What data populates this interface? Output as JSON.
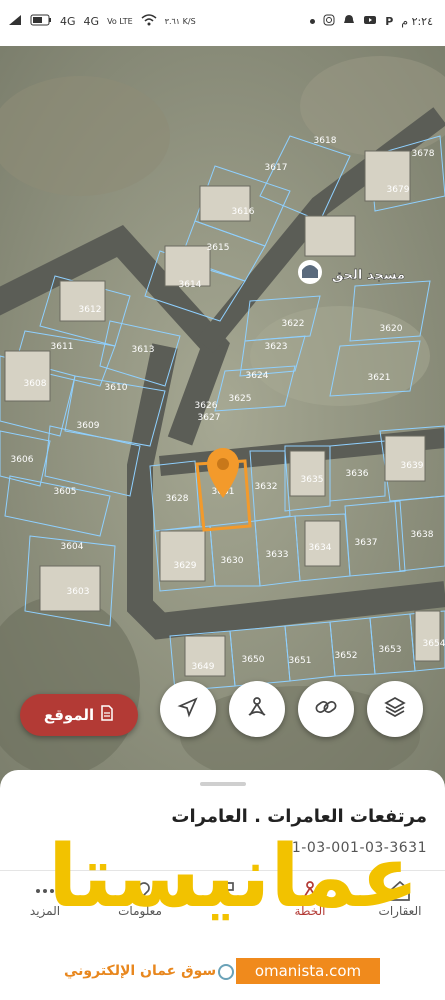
{
  "status_bar": {
    "network_1": "4G",
    "network_2": "4G",
    "volte": "Vo LTE",
    "speed": "٣.٦١ K/S",
    "time": "٢:٢٤ م"
  },
  "map": {
    "parcels": [
      "3618",
      "3617",
      "3616",
      "3615",
      "3614",
      "3612",
      "3611",
      "3613",
      "3608",
      "3610",
      "3609",
      "3606",
      "3605",
      "3604",
      "3603",
      "3622",
      "3623",
      "3624",
      "3625",
      "3626",
      "3627",
      "3620",
      "3621",
      "3678",
      "3679",
      "3639",
      "3636",
      "3635",
      "3632",
      "3631",
      "3628",
      "3629",
      "3630",
      "3633",
      "3634",
      "3637",
      "3638",
      "3649",
      "3650",
      "3651",
      "3652",
      "3653",
      "3654"
    ],
    "landmark_label": "مسجد الحق",
    "selected_parcel": "3631"
  },
  "location_button": {
    "label": "الموقع"
  },
  "fab_buttons": [
    "layers-icon",
    "link-icon",
    "measure-icon",
    "navigate-icon"
  ],
  "sheet": {
    "title": "مرتفعات العامرات . العامرات",
    "code": "01-03-001-03-3631"
  },
  "nav": {
    "properties": "العقارات",
    "plan": "الخطة",
    "info": "معلومات",
    "more": "المزيد"
  },
  "watermark": {
    "logo": "عمانيستا",
    "tagline": "سوق عمان الإلكتروني",
    "url": "omanista.com"
  },
  "colors": {
    "accent": "#b33a35",
    "selection": "#f39a2b",
    "parcel_border": "#8fd0ff",
    "watermark": "#f2c200"
  }
}
